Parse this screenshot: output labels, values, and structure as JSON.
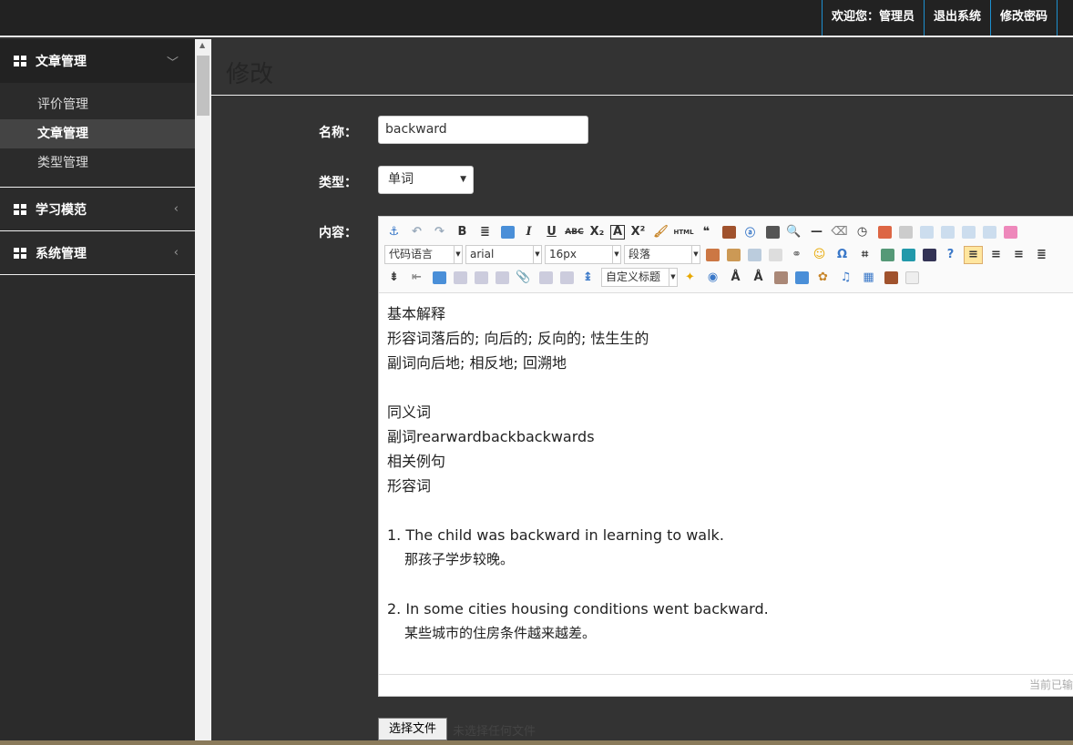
{
  "topnav": {
    "welcome": "欢迎您：管理员",
    "logout": "退出系统",
    "change_password": "修改密码"
  },
  "sidebar": {
    "groups": [
      {
        "label": "文章管理",
        "expanded": true,
        "chevron": "chevron-down-icon",
        "items": [
          {
            "label": "评价管理",
            "active": false
          },
          {
            "label": "文章管理",
            "active": true
          },
          {
            "label": "类型管理",
            "active": false
          }
        ]
      },
      {
        "label": "学习模范",
        "expanded": false,
        "chevron": "chevron-left-icon"
      },
      {
        "label": "系统管理",
        "expanded": false,
        "chevron": "chevron-left-icon"
      }
    ]
  },
  "page": {
    "title": "修改"
  },
  "form": {
    "name_label": "名称：",
    "name_value": "backward",
    "type_label": "类型：",
    "type_value": "单词",
    "content_label": "内容："
  },
  "editor": {
    "toolbar": {
      "code_language": "代码语言",
      "font_family": "arial",
      "font_size": "16px",
      "paragraph": "段落",
      "custom_heading": "自定义标题"
    },
    "content": [
      "基本解释",
      "形容词落后的; 向后的; 反向的; 怯生生的",
      "副词向后地; 相反地; 回溯地",
      "",
      "同义词",
      "副词rearwardbackbackwards",
      "相关例句",
      "形容词",
      "",
      "1. The child was backward in learning to walk.",
      "那孩子学步较晚。",
      "",
      "2. In some cities housing conditions went backward.",
      "某些城市的住房条件越来越差。"
    ],
    "status": "当前已输"
  },
  "file": {
    "button": "选择文件",
    "no_file": "未选择任何文件"
  },
  "colors": {
    "topbar": "#222222",
    "sidebar": "#2b2b2b",
    "main_bg": "#333333",
    "nav_border": "#1d8fcf",
    "active_item": "#444444"
  }
}
